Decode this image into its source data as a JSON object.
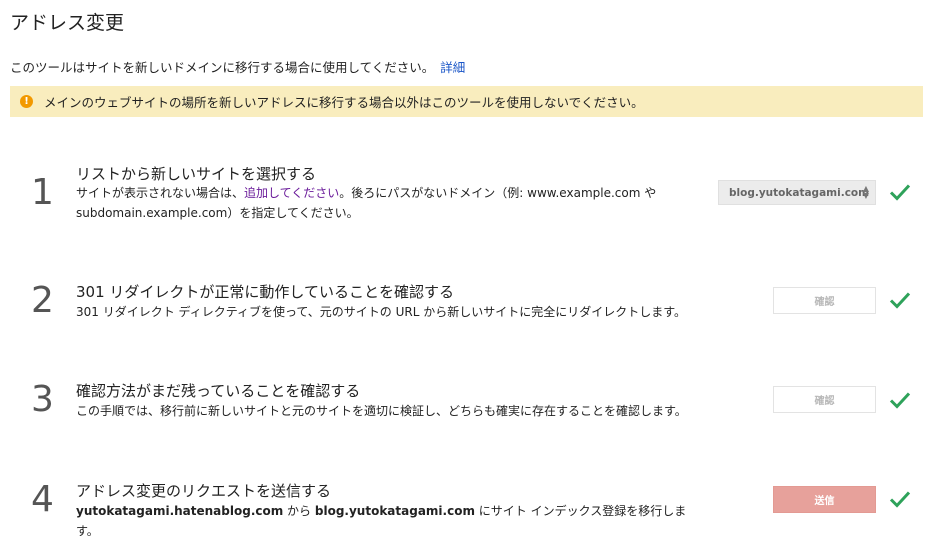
{
  "page": {
    "title": "アドレス変更",
    "intro_text": "このツールはサイトを新しいドメインに移行する場合に使用してください。",
    "intro_link": "詳細"
  },
  "warning": {
    "icon": "alert-circle-icon",
    "text": "メインのウェブサイトの場所を新しいアドレスに移行する場合以外はこのツールを使用しないでください。",
    "color": "#f9edbe"
  },
  "steps": [
    {
      "number": "1",
      "title": "リストから新しいサイトを選択する",
      "desc_pre": "サイトが表示されない場合は、",
      "desc_link": "追加してください",
      "desc_post": "。後ろにパスがないドメイン（例: www.example.com や subdomain.example.com）を指定してください。",
      "select_value": "blog.yutokatagami.com",
      "status_icon": "check-icon"
    },
    {
      "number": "2",
      "title": "301 リダイレクトが正常に動作していることを確認する",
      "desc": "301 リダイレクト ディレクティブを使って、元のサイトの URL から新しいサイトに完全にリダイレクトします。",
      "button_label": "確認",
      "status_icon": "check-icon"
    },
    {
      "number": "3",
      "title": "確認方法がまだ残っていることを確認する",
      "desc": "この手順では、移行前に新しいサイトと元のサイトを適切に検証し、どちらも確実に存在することを確認します。",
      "button_label": "確認",
      "status_icon": "check-icon"
    },
    {
      "number": "4",
      "title": "アドレス変更のリクエストを送信する",
      "desc_from": "yutokatagami.hatenablog.com",
      "desc_mid": " から ",
      "desc_to": "blog.yutokatagami.com",
      "desc_post": " にサイト インデックス登録を移行します。",
      "button_label": "送信",
      "status_icon": "check-icon"
    }
  ],
  "colors": {
    "check": "#2ea25a",
    "submit_button": "#e7a19b",
    "link": "#1a56c8"
  }
}
